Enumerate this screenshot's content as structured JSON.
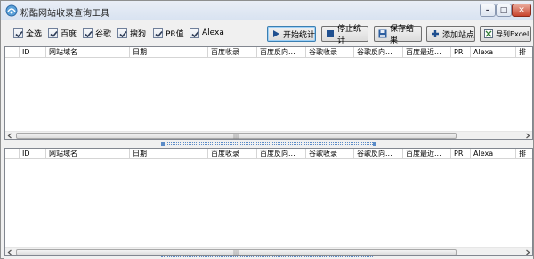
{
  "window": {
    "title": "粉酷网站收录查询工具",
    "controls": {
      "minimize": "–",
      "maximize": "□",
      "close": "✕"
    }
  },
  "toolbar": {
    "checkboxes": [
      {
        "label": "全选",
        "checked": true
      },
      {
        "label": "百度",
        "checked": true
      },
      {
        "label": "谷歌",
        "checked": true
      },
      {
        "label": "搜狗",
        "checked": true
      },
      {
        "label": "PR值",
        "checked": true
      },
      {
        "label": "Alexa",
        "checked": true
      }
    ],
    "buttons": {
      "start": "开始统计",
      "stop": "停止统计",
      "save": "保存结果",
      "add_site": "添加站点",
      "export": "导到Excel"
    }
  },
  "grid_top": {
    "columns": [
      "ID",
      "网站域名",
      "日期",
      "百度收录",
      "百度反向...",
      "谷歌收录",
      "谷歌反向...",
      "百度最近...",
      "PR",
      "Alexa",
      "排"
    ]
  },
  "grid_bottom": {
    "columns": [
      "ID",
      "网站域名",
      "日期",
      "百度收录",
      "百度反向...",
      "谷歌收录",
      "谷歌反向...",
      "百度最近...",
      "PR",
      "Alexa",
      "排"
    ]
  },
  "scrollbar": {
    "grip": "|||"
  },
  "colors": {
    "accent": "#3c7fb1",
    "splitter": "#5b8bc7"
  }
}
